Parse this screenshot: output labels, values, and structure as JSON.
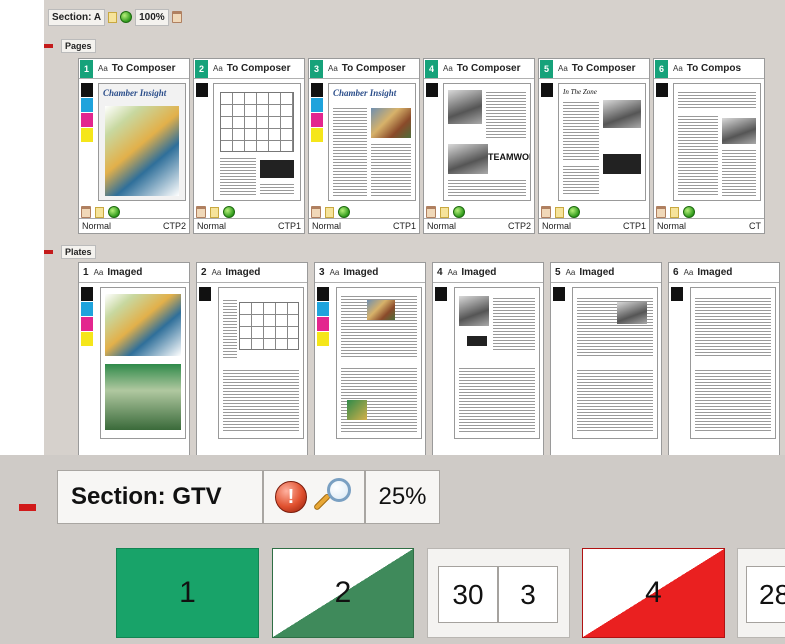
{
  "top_panel": {
    "section_label": "Section: A",
    "zoom": "100%",
    "pages_label": "Pages",
    "plates_label": "Plates",
    "pages": [
      {
        "number": "1",
        "status": "To Composer",
        "mode": "Normal",
        "device": "CTP2",
        "masthead": "Chamber Insight"
      },
      {
        "number": "2",
        "status": "To Composer",
        "mode": "Normal",
        "device": "CTP1",
        "masthead": ""
      },
      {
        "number": "3",
        "status": "To Composer",
        "mode": "Normal",
        "device": "CTP1",
        "masthead": "Chamber Insight"
      },
      {
        "number": "4",
        "status": "To Composer",
        "mode": "Normal",
        "device": "CTP2",
        "masthead": "TEAMWORK"
      },
      {
        "number": "5",
        "status": "To Composer",
        "mode": "Normal",
        "device": "CTP1",
        "masthead": "In The Zone"
      },
      {
        "number": "6",
        "status": "To Compos",
        "mode": "Normal",
        "device": "CT",
        "masthead": ""
      }
    ],
    "plates": [
      {
        "number": "1",
        "status": "Imaged"
      },
      {
        "number": "2",
        "status": "Imaged"
      },
      {
        "number": "3",
        "status": "Imaged"
      },
      {
        "number": "4",
        "status": "Imaged"
      },
      {
        "number": "5",
        "status": "Imaged"
      },
      {
        "number": "6",
        "status": "Imaged"
      }
    ],
    "colors": {
      "accent_green": "#16a27a",
      "cyan": "#1fa3dc",
      "magenta": "#e3268e",
      "yellow": "#f5e61a",
      "black": "#111111"
    }
  },
  "bottom_panel": {
    "section_label": "Section: GTV",
    "zoom": "25%",
    "icons": [
      "warning-icon",
      "magnifier-icon"
    ],
    "tiles": [
      {
        "label": "1",
        "state": "green"
      },
      {
        "label": "2",
        "state": "half-green"
      },
      {
        "labels": [
          "30",
          "3"
        ],
        "state": "pair"
      },
      {
        "label": "4",
        "state": "half-red"
      },
      {
        "label": "28",
        "state": "pair-partial"
      }
    ],
    "colors": {
      "green": "#18a369",
      "dark_green": "#3f8a5b",
      "red": "#ea2020",
      "minus_red": "#d11a1a"
    }
  }
}
